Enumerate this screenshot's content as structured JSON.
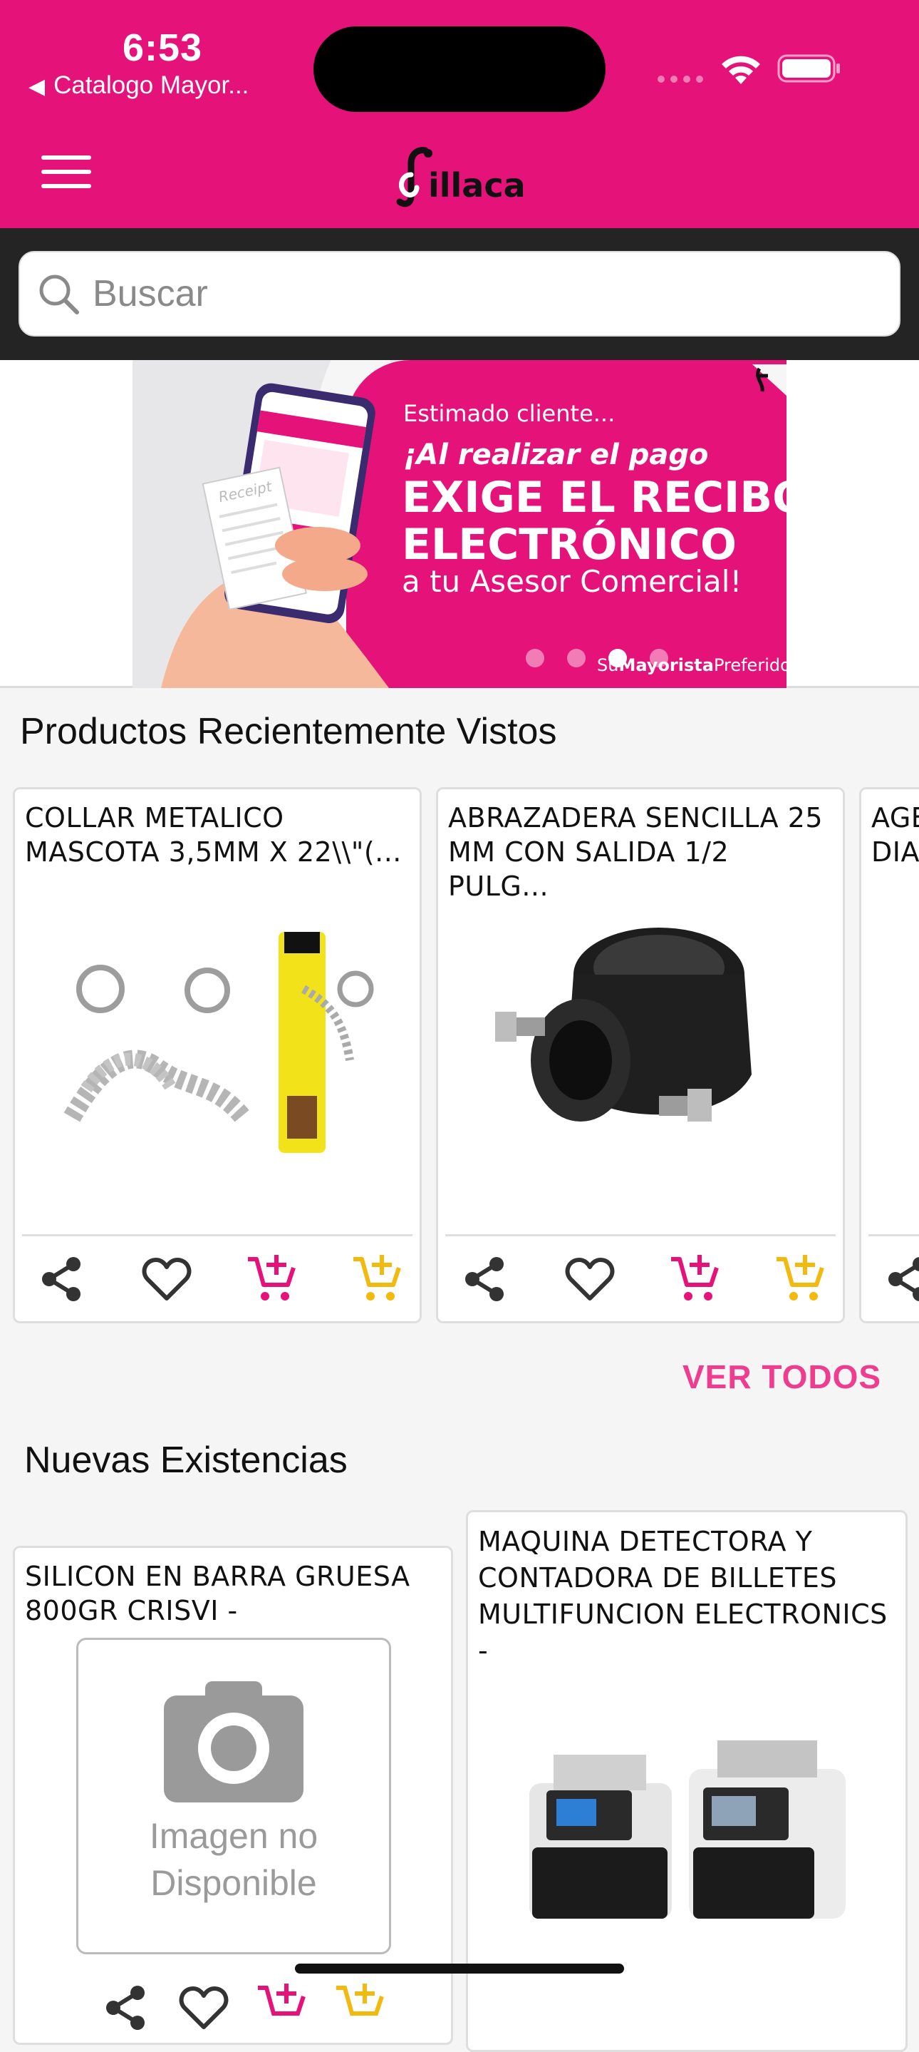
{
  "status_bar": {
    "time": "6:53",
    "back_app": "Catalogo Mayor..."
  },
  "header": {
    "logo_text": "illaca",
    "accent_color": "#e5127a"
  },
  "search": {
    "placeholder": "Buscar"
  },
  "banner": {
    "line1": "Estimado cliente...",
    "line2": "¡Al realizar el pago",
    "line3": "EXIGE EL RECIBO",
    "line4": "ELECTRÓNICO",
    "line5": "a tu Asesor Comercial!",
    "tag_prefix": "Su",
    "tag_bold": "Mayorista",
    "tag_suffix": "Preferido",
    "receipt_label": "Receipt",
    "active_dot": 2
  },
  "recent": {
    "title": "Productos Recientemente Vistos",
    "products": [
      {
        "name": "COLLAR METALICO MASCOTA 3,5MM X 22\\\\\"(..."
      },
      {
        "name": "ABRAZADERA SENCILLA 25 MM CON SALIDA 1/2 PULG..."
      },
      {
        "name": "AGE DIA"
      }
    ],
    "view_all": "VER TODOS"
  },
  "new_stock": {
    "title": "Nuevas Existencias",
    "products": [
      {
        "name": "SILICON EN BARRA GRUESA 800GR CRISVI -",
        "image_text_1": "Imagen no",
        "image_text_2": "Disponible"
      },
      {
        "name": "MAQUINA DETECTORA Y CONTADORA DE BILLETES MULTIFUNCION ELECTRONICS -"
      }
    ]
  },
  "icons": {
    "share": "share-icon",
    "favorite": "heart-icon",
    "add_cart": "cart-plus-icon",
    "quick_cart": "cart-plus-icon"
  }
}
